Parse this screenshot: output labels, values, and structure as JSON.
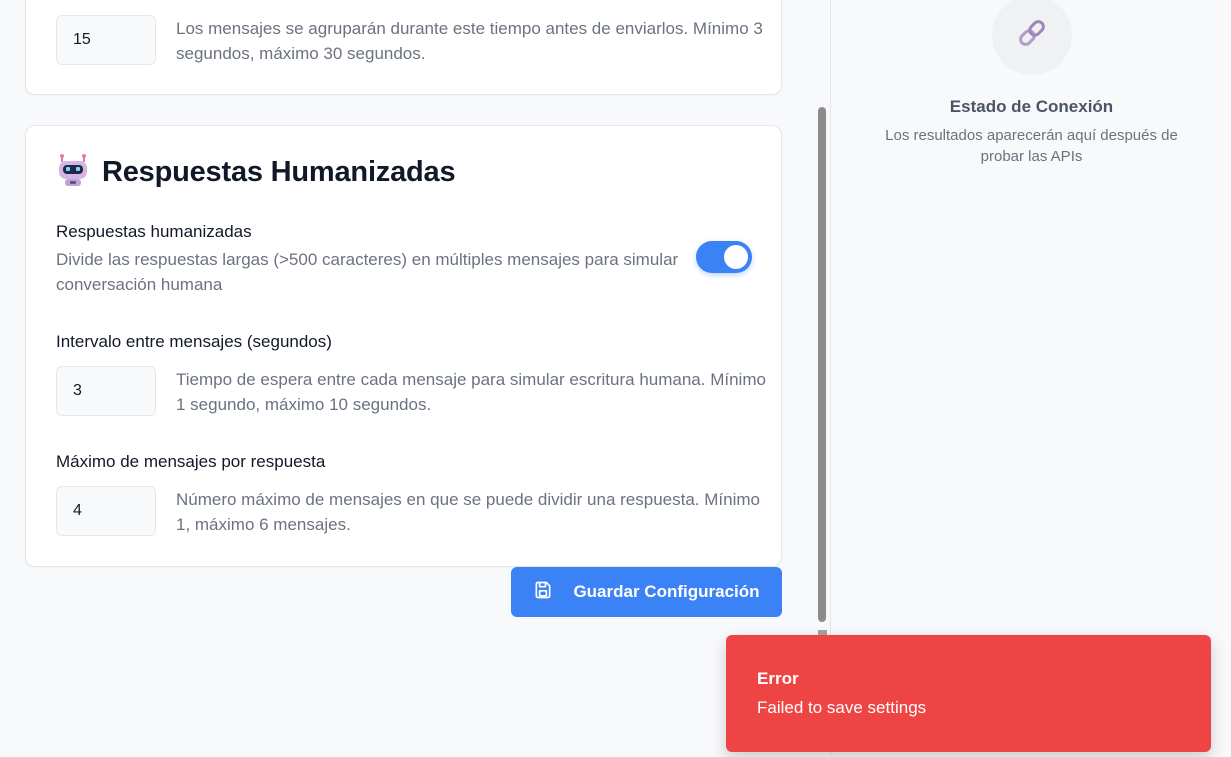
{
  "grouping": {
    "value": "15",
    "help": "Los mensajes se agruparán durante este tiempo antes de enviarlos. Mínimo 3 segundos, máximo 30 segundos."
  },
  "humanized": {
    "title": "Respuestas Humanizadas",
    "title_icon": "robot-icon",
    "toggle": {
      "label": "Respuestas humanizadas",
      "description": "Divide las respuestas largas (>500 caracteres) en múltiples mensajes para simular conversación humana",
      "enabled": true
    },
    "interval": {
      "label": "Intervalo entre mensajes (segundos)",
      "value": "3",
      "help": "Tiempo de espera entre cada mensaje para simular escritura humana. Mínimo 1 segundo, máximo 10 segundos."
    },
    "max_messages": {
      "label": "Máximo de mensajes por respuesta",
      "value": "4",
      "help": "Número máximo de mensajes en que se puede dividir una respuesta. Mínimo 1, máximo 6 mensajes."
    }
  },
  "actions": {
    "save_label": "Guardar Configuración",
    "save_icon": "save-icon"
  },
  "connection": {
    "icon": "link-icon",
    "title": "Estado de Conexión",
    "subtitle": "Los resultados aparecerán aquí después de probar las APIs"
  },
  "toast": {
    "title": "Error",
    "message": "Failed to save settings"
  },
  "colors": {
    "accent": "#3b82f6",
    "error": "#ef4444",
    "muted_text": "#6b7280"
  }
}
